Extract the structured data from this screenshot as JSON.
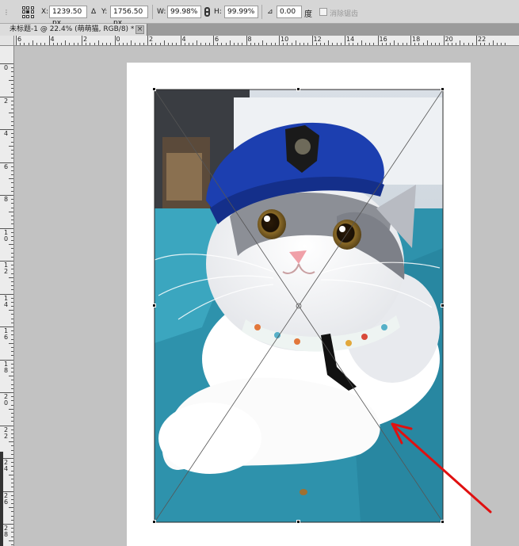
{
  "options_bar": {
    "x_label": "X:",
    "x_value": "1239.50 px",
    "delta_label": "Δ",
    "y_label": "Y:",
    "y_value": "1756.50 px",
    "w_label": "W:",
    "w_value": "99.98%",
    "h_label": "H:",
    "h_value": "99.99%",
    "angle_label": "⊿",
    "angle_value": "0.00",
    "angle_unit": "度",
    "antialias_label": "消除锯齿"
  },
  "document_tab": {
    "title": "未标题-1 @ 22.4% (萌萌猫, RGB/8) *",
    "close_glyph": "×"
  },
  "ruler_top_labels": [
    "6",
    "4",
    "2",
    "0",
    "2",
    "4",
    "6",
    "8",
    "10",
    "12",
    "14",
    "16",
    "18",
    "20",
    "22"
  ],
  "ruler_left_labels": [
    "0",
    "2",
    "4",
    "6",
    "8",
    "1\n0",
    "1\n2",
    "1\n4",
    "1\n6",
    "1\n8",
    "2\n0",
    "2\n2",
    "2\n4",
    "2\n6",
    "2\n8"
  ],
  "colors": {
    "canvas_bg": "#c2c2c2",
    "paper": "#ffffff",
    "hat": "#1c3fb0",
    "table": "#2e92ac",
    "arrow": "#e01010"
  },
  "icons": {
    "reference_point": "reference-point-grid-icon",
    "link": "link-icon",
    "annotation": "red-arrow-annotation"
  }
}
